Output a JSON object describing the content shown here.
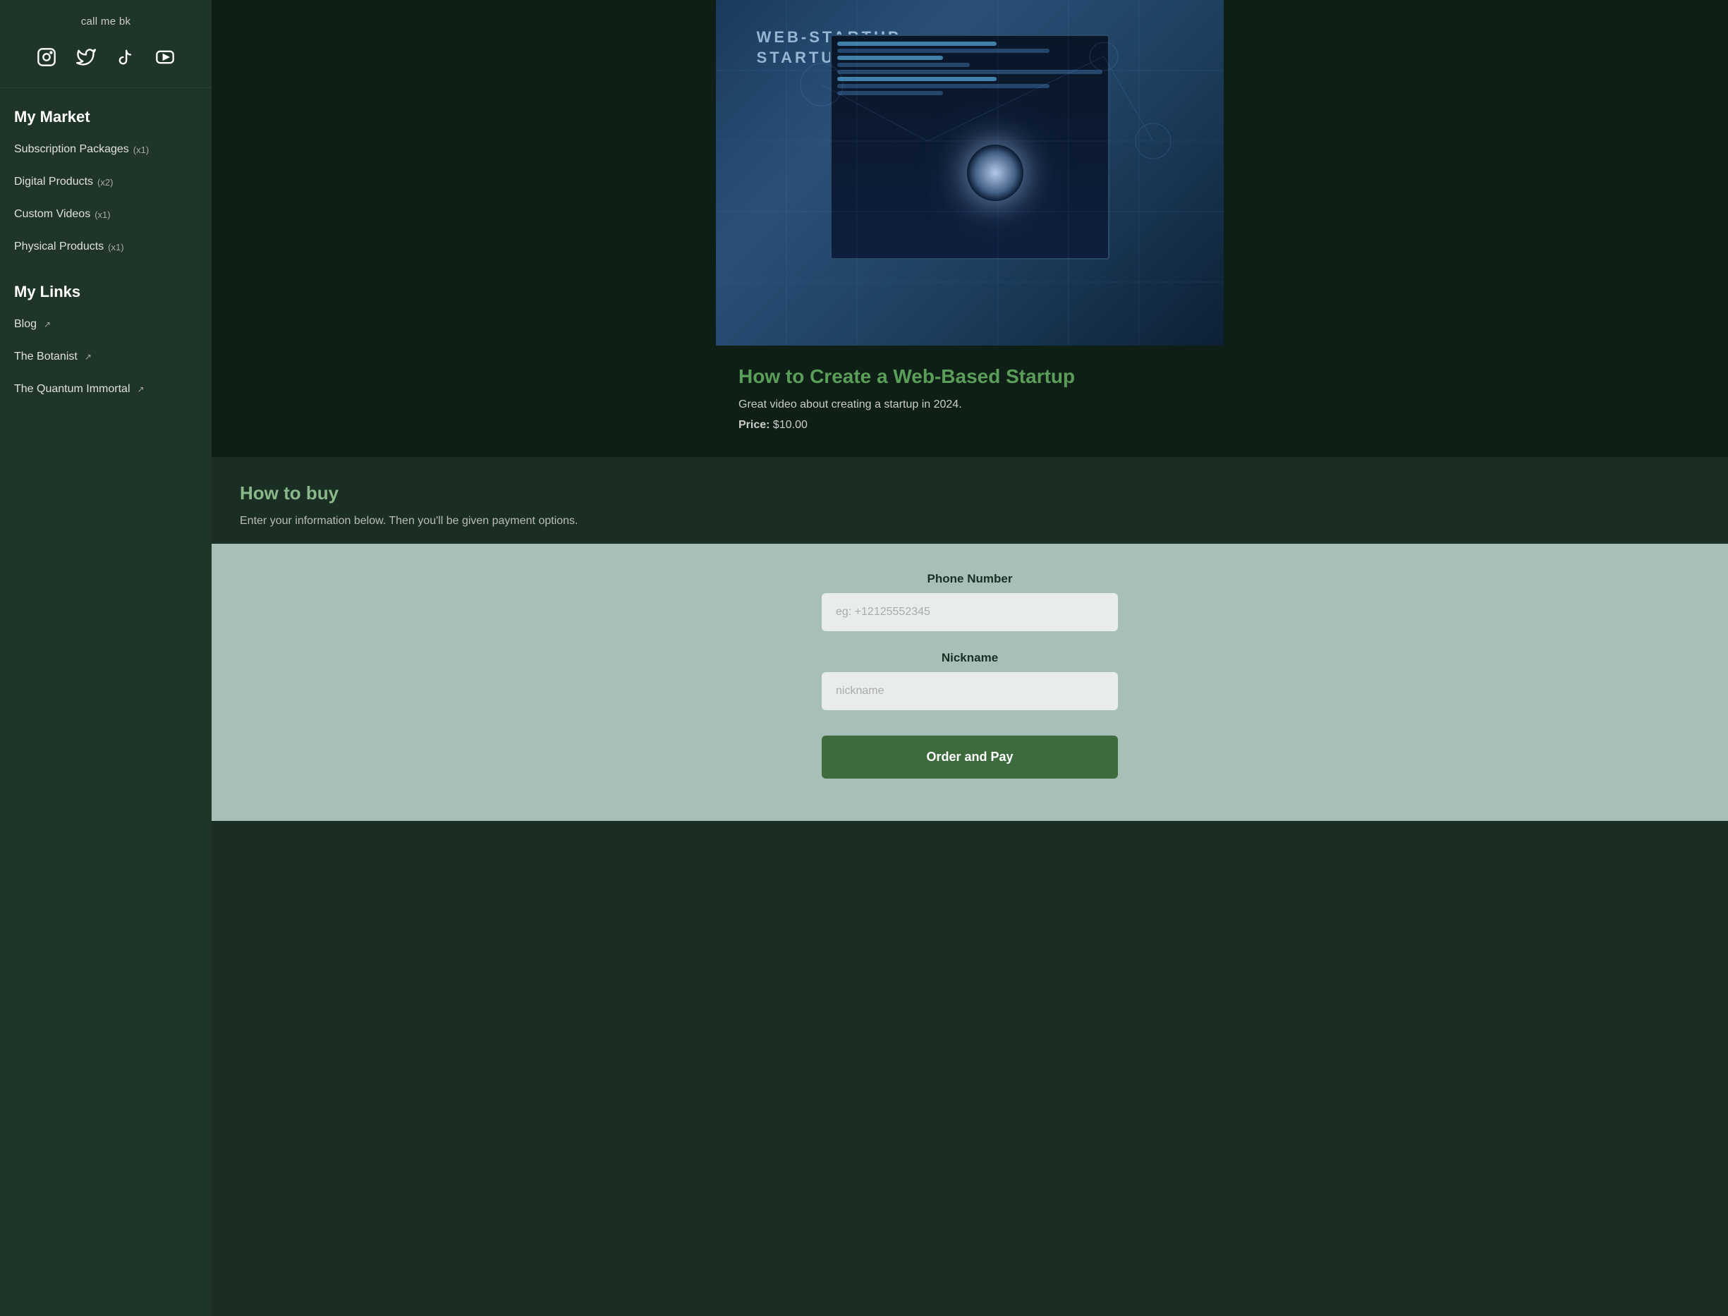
{
  "sidebar": {
    "username": "call me bk",
    "social": [
      {
        "name": "instagram",
        "label": "Instagram"
      },
      {
        "name": "twitter",
        "label": "Twitter"
      },
      {
        "name": "tiktok",
        "label": "TikTok"
      },
      {
        "name": "youtube",
        "label": "YouTube"
      }
    ],
    "my_market": {
      "title": "My Market",
      "items": [
        {
          "label": "Subscription Packages",
          "count": "(x1)",
          "link": false
        },
        {
          "label": "Digital Products",
          "count": "(x2)",
          "link": false
        },
        {
          "label": "Custom Videos",
          "count": "(x1)",
          "link": false
        },
        {
          "label": "Physical Products",
          "count": "(x1)",
          "link": false
        }
      ]
    },
    "my_links": {
      "title": "My Links",
      "items": [
        {
          "label": "Blog",
          "link": true
        },
        {
          "label": "The Botanist",
          "link": true
        },
        {
          "label": "The Quantum Immortal",
          "link": true
        }
      ]
    }
  },
  "product": {
    "title": "How to Create a Web-Based Startup",
    "description": "Great video about creating a startup in 2024.",
    "price_label": "Price:",
    "price": "$10.00",
    "image_text_line1": "WEB-STARTUP",
    "image_text_line2": "STARTUP"
  },
  "how_to_buy": {
    "title": "How to buy",
    "description": "Enter your information below. Then you'll be given payment options."
  },
  "form": {
    "phone_label": "Phone Number",
    "phone_placeholder": "eg: +12125552345",
    "nickname_label": "Nickname",
    "nickname_placeholder": "nickname",
    "button_label": "Order and Pay"
  }
}
